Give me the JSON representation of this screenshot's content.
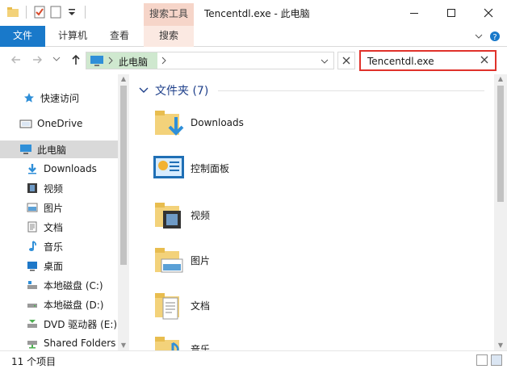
{
  "window": {
    "title": "Tencentdl.exe - 此电脑",
    "contextual_tab_group": "搜索工具"
  },
  "ribbon": {
    "tabs": [
      {
        "label": "文件"
      },
      {
        "label": "计算机"
      },
      {
        "label": "查看"
      },
      {
        "label": "搜索"
      }
    ]
  },
  "address": {
    "breadcrumb": "此电脑"
  },
  "search": {
    "value": "Tencentdl.exe"
  },
  "nav": {
    "items": [
      {
        "label": "快速访问",
        "icon": "star-icon"
      },
      {
        "label": "OneDrive",
        "icon": "cloud-icon"
      },
      {
        "label": "此电脑",
        "icon": "computer-icon",
        "selected": true
      },
      {
        "label": "Downloads",
        "icon": "download-arrow-icon"
      },
      {
        "label": "视频",
        "icon": "film-icon"
      },
      {
        "label": "图片",
        "icon": "picture-icon"
      },
      {
        "label": "文档",
        "icon": "document-icon"
      },
      {
        "label": "音乐",
        "icon": "music-note-icon"
      },
      {
        "label": "桌面",
        "icon": "desktop-icon"
      },
      {
        "label": "本地磁盘 (C:)",
        "icon": "windows-drive-icon"
      },
      {
        "label": "本地磁盘 (D:)",
        "icon": "drive-icon"
      },
      {
        "label": "DVD 驱动器 (E:)",
        "icon": "dvd-icon"
      },
      {
        "label": "Shared Folders",
        "icon": "network-drive-icon"
      }
    ]
  },
  "content": {
    "group_title": "文件夹 (7)",
    "items": [
      {
        "label": "Downloads",
        "icon": "downloads-folder-icon"
      },
      {
        "label": "控制面板",
        "icon": "control-panel-icon"
      },
      {
        "label": "视频",
        "icon": "videos-folder-icon"
      },
      {
        "label": "图片",
        "icon": "pictures-folder-icon"
      },
      {
        "label": "文档",
        "icon": "documents-folder-icon"
      },
      {
        "label": "音乐",
        "icon": "music-folder-icon"
      }
    ]
  },
  "status": {
    "text": "11 个项目"
  },
  "colors": {
    "accent": "#1979ca",
    "context_tab": "#f6d5c9",
    "search_highlight": "#e0322b",
    "folder": "#f3d27a",
    "group_title": "#1e3f8a"
  }
}
